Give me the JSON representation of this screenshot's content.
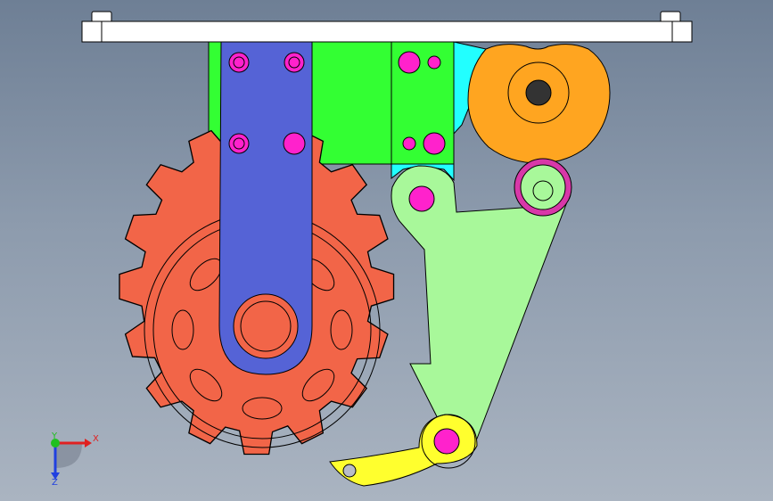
{
  "viewport": {
    "background_top": "#6e7f95",
    "background_bottom": "#aab4c1"
  },
  "parts": {
    "top_plate": {
      "color": "#ffffff"
    },
    "green_block": {
      "color": "#33ff33"
    },
    "blue_arm": {
      "color": "#5563d6"
    },
    "cyan_bracket": {
      "color": "#22ffff"
    },
    "cam": {
      "color": "#ffa520"
    },
    "sprocket": {
      "color": "#f26548"
    },
    "tensioner_arm": {
      "color": "#a8f89a"
    },
    "pawl": {
      "color": "#ffff2e"
    },
    "holes": {
      "color": "#ff22cc"
    }
  },
  "triad": {
    "x_label": "X",
    "y_label": "Y",
    "z_label": "Z",
    "x_color": "#e02020",
    "y_color": "#20c020",
    "z_color": "#2040e0"
  }
}
